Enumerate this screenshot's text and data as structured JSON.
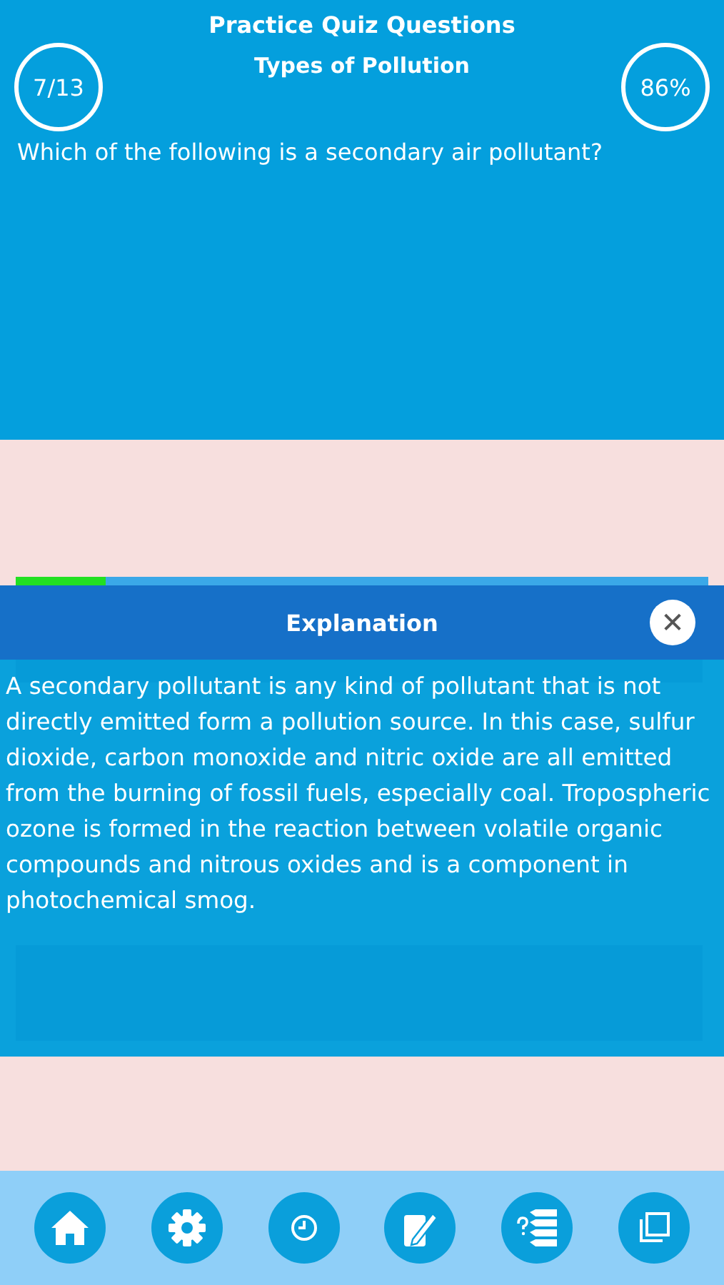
{
  "header": {
    "title": "Practice Quiz Questions",
    "subtitle": "Types of Pollution",
    "progress_count": "7/13",
    "score": "86%"
  },
  "question": "Which of the following is a secondary air pollutant?",
  "progress": {
    "level": 0.13
  },
  "explanation": {
    "title": "Explanation",
    "close_icon": "✕",
    "text": "A secondary pollutant is any kind of pollutant that is not directly emitted form a pollution source. In this case, sulfur dioxide, carbon monoxide and nitric oxide are all emitted from the burning of fossil fuels, especially coal. Tropospheric ozone is formed in the reaction between volatile organic compounds and nitrous oxides and is a component in photochemical smog."
  },
  "nav": [
    {
      "kind": "home"
    },
    {
      "kind": "settings"
    },
    {
      "kind": "clock"
    },
    {
      "kind": "notes"
    },
    {
      "kind": "list"
    },
    {
      "kind": "copy"
    }
  ]
}
